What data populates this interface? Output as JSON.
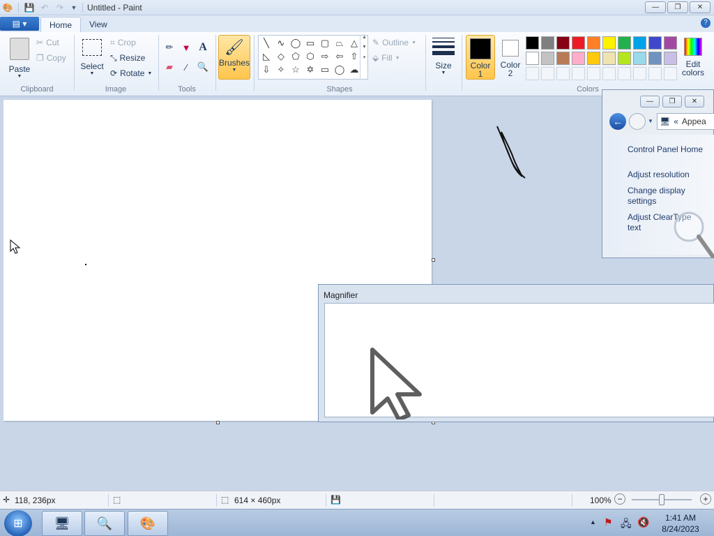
{
  "window": {
    "title": "Untitled - Paint",
    "minimize": "—",
    "maximize": "❐",
    "close": "✕"
  },
  "tabs": {
    "file": "▤ ▾",
    "home": "Home",
    "view": "View",
    "help": "?"
  },
  "clipboard": {
    "paste": "Paste",
    "cut": "Cut",
    "copy": "Copy",
    "label": "Clipboard"
  },
  "image": {
    "select": "Select",
    "crop": "Crop",
    "resize": "Resize",
    "rotate": "Rotate",
    "label": "Image"
  },
  "tools": {
    "label": "Tools"
  },
  "brushes": {
    "label": "Brushes"
  },
  "shapes": {
    "outline": "Outline",
    "fill": "Fill",
    "label": "Shapes"
  },
  "size": {
    "label": "Size"
  },
  "color": {
    "color1_line1": "Color",
    "color1_line2": "1",
    "color2_line1": "Color",
    "color2_line2": "2",
    "edit_line1": "Edit",
    "edit_line2": "colors",
    "label": "Colors",
    "color1_value": "#000000",
    "color2_value": "#ffffff",
    "palette_row1": [
      "#000000",
      "#7f7f7f",
      "#880015",
      "#ed1c24",
      "#ff7f27",
      "#fff200",
      "#22b14c",
      "#00a2e8",
      "#3f48cc",
      "#a349a4"
    ],
    "palette_row2": [
      "#ffffff",
      "#c3c3c3",
      "#b97a57",
      "#ffaec9",
      "#ffc90e",
      "#efe4b0",
      "#b5e61d",
      "#99d9ea",
      "#7092be",
      "#c8bfe7"
    ]
  },
  "control_panel": {
    "address_prefix": "«",
    "address": "Appea",
    "home": "Control Panel Home",
    "resolution": "Adjust resolution",
    "display_line1": "Change display",
    "display_line2": "settings",
    "cleartype_line1": "Adjust ClearType",
    "cleartype_line2": "text"
  },
  "magnifier": {
    "title": "Magnifier"
  },
  "status": {
    "cursor_pos": "118, 236px",
    "canvas_size": "614 × 460px",
    "zoom": "100%"
  },
  "taskbar": {
    "time": "1:41 AM",
    "date": "8/24/2023"
  }
}
